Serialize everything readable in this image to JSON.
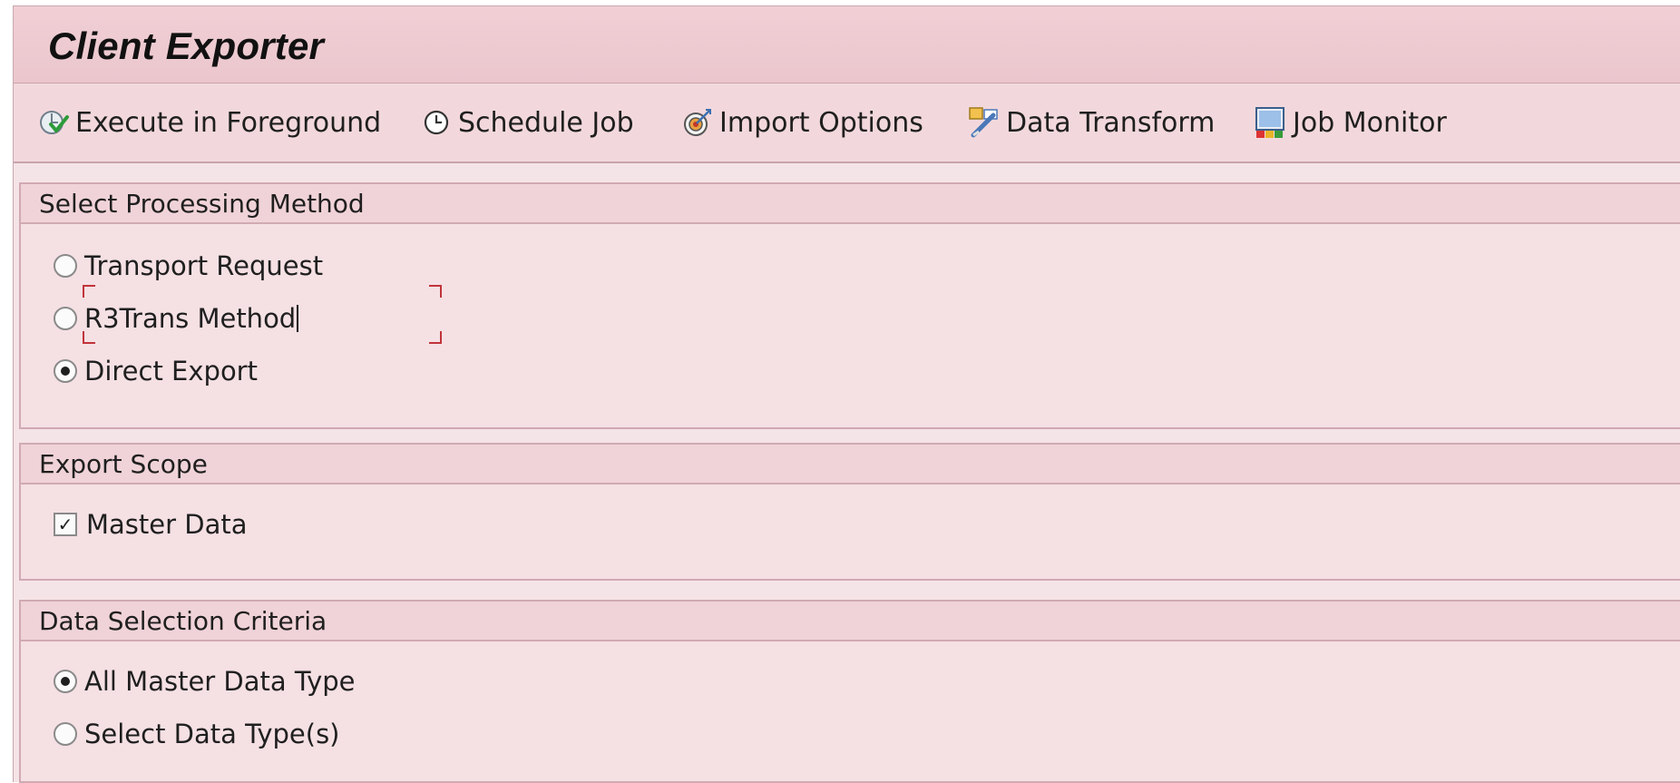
{
  "app": {
    "title": "Client Exporter"
  },
  "toolbar": {
    "items": [
      {
        "label": "Execute in Foreground",
        "icon": "execute-icon"
      },
      {
        "label": "Schedule Job",
        "icon": "clock-icon"
      },
      {
        "label": "Import Options",
        "icon": "target-icon"
      },
      {
        "label": "Data Transform",
        "icon": "transform-icon"
      },
      {
        "label": "Job Monitor",
        "icon": "monitor-icon"
      }
    ]
  },
  "processing_method": {
    "header": "Select Processing Method",
    "options": [
      {
        "label": "Transport Request",
        "selected": false
      },
      {
        "label": "R3Trans Method",
        "selected": false,
        "focused": true
      },
      {
        "label": "Direct Export",
        "selected": true
      }
    ]
  },
  "export_scope": {
    "header": "Export Scope",
    "options": [
      {
        "label": "Master Data",
        "checked": true
      }
    ]
  },
  "data_selection": {
    "header": "Data Selection Criteria",
    "options": [
      {
        "label": "All Master Data Type",
        "selected": true
      },
      {
        "label": "Select Data Type(s)",
        "selected": false
      }
    ]
  },
  "colors": {
    "background": "#f5e4e7",
    "title_bar": "#ebc6cd",
    "panel_header": "#f0d3d8",
    "focus_frame": "#c0343a"
  }
}
